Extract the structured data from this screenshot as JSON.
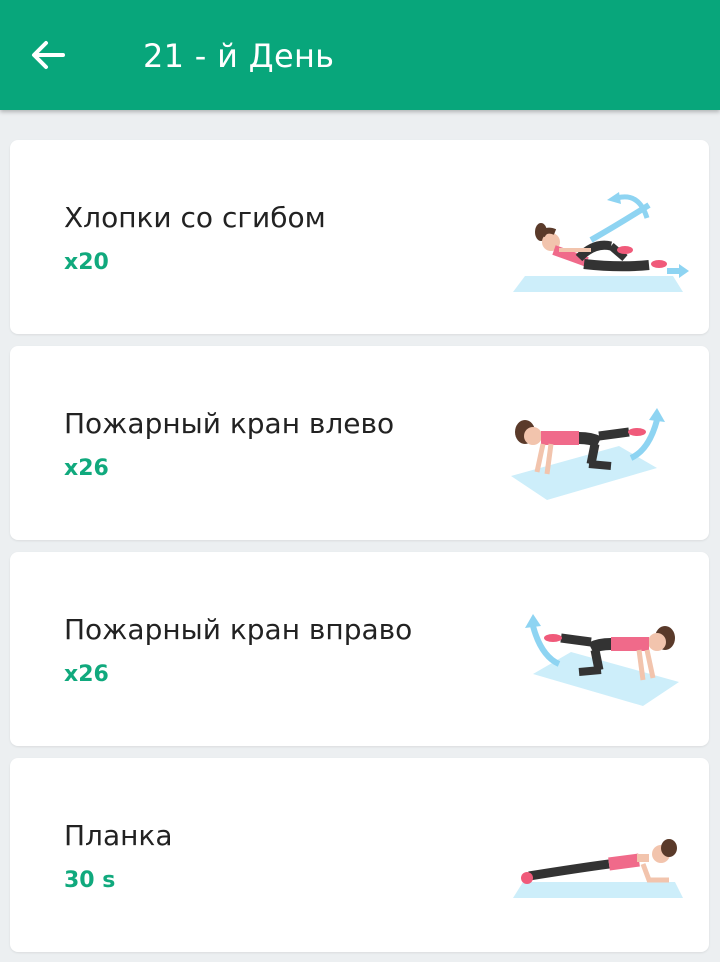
{
  "header": {
    "title": "21 - й День",
    "back_icon": "arrow-left-icon",
    "background": "#08a67b"
  },
  "exercises": [
    {
      "name": "Хлопки со сгибом",
      "reps": "x20",
      "illustration": "v-up-clap-illustration"
    },
    {
      "name": "Пожарный кран влево",
      "reps": "x26",
      "illustration": "fire-hydrant-left-illustration"
    },
    {
      "name": "Пожарный кран вправо",
      "reps": "x26",
      "illustration": "fire-hydrant-right-illustration"
    },
    {
      "name": "Планка",
      "reps": "30 s",
      "illustration": "plank-illustration"
    }
  ],
  "colors": {
    "accent": "#10a97d",
    "page_background": "#eceff1",
    "card": "#ffffff"
  }
}
